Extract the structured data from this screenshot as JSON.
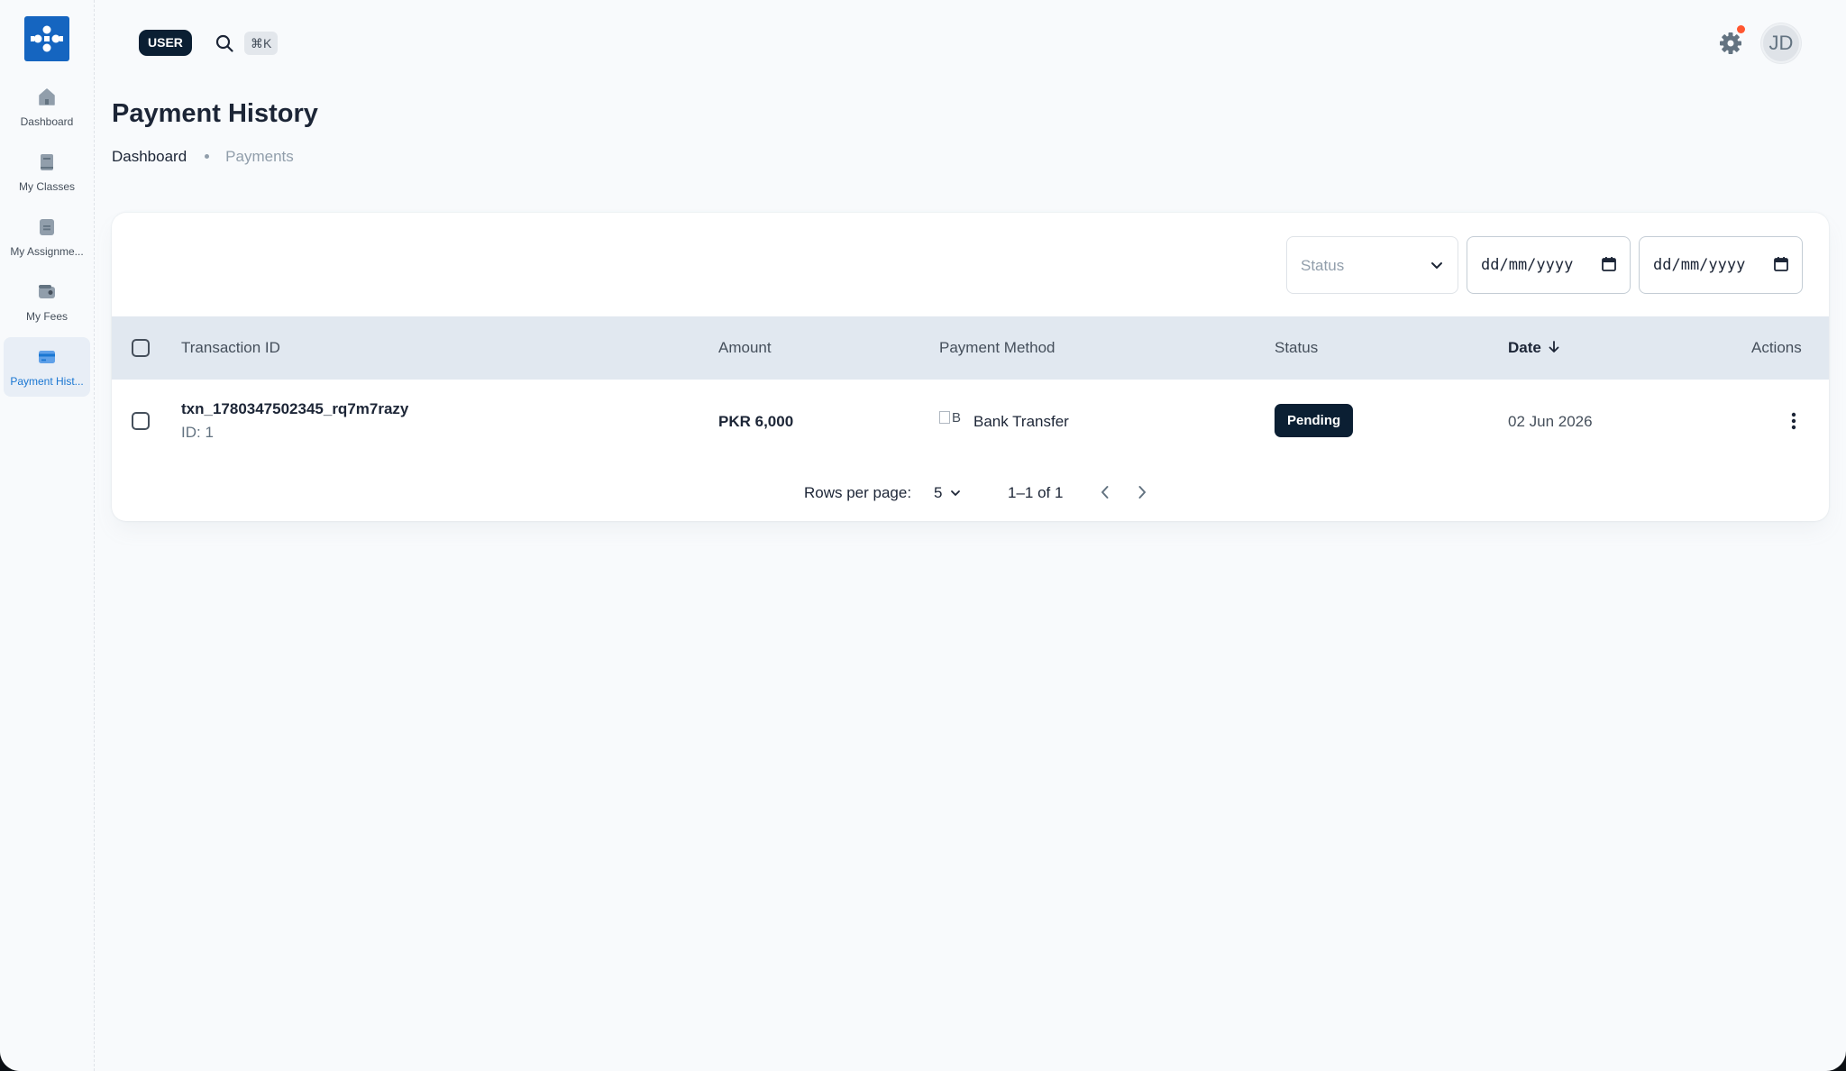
{
  "sidebar": {
    "items": [
      {
        "label": "Dashboard",
        "icon": "home-icon"
      },
      {
        "label": "My Classes",
        "icon": "book-icon"
      },
      {
        "label": "My Assignme...",
        "icon": "document-icon"
      },
      {
        "label": "My Fees",
        "icon": "wallet-icon"
      },
      {
        "label": "Payment Hist...",
        "icon": "credit-card-icon",
        "active": true
      }
    ]
  },
  "header": {
    "role_chip": "USER",
    "search_shortcut": "⌘K",
    "avatar_initials": "JD"
  },
  "page": {
    "title": "Payment History",
    "breadcrumb": {
      "home": "Dashboard",
      "current": "Payments"
    }
  },
  "filters": {
    "status_placeholder": "Status",
    "date_from_placeholder": "dd/mm/yyyy",
    "date_to_placeholder": "dd/mm/yyyy"
  },
  "table": {
    "columns": {
      "transaction_id": "Transaction ID",
      "amount": "Amount",
      "payment_method": "Payment Method",
      "status": "Status",
      "date": "Date",
      "actions": "Actions"
    },
    "sorted_by": "Date",
    "rows": [
      {
        "transaction_id": "txn_1780347502345_rq7m7razy",
        "id_label": "ID: 1",
        "amount": "PKR 6,000",
        "method_img_alt": "B",
        "payment_method": "Bank Transfer",
        "status": "Pending",
        "date": "02 Jun 2026"
      }
    ]
  },
  "pagination": {
    "rows_per_page_label": "Rows per page:",
    "rows_per_page": "5",
    "range": "1–1 of 1"
  },
  "colors": {
    "brand": "#1565c0",
    "dark": "#0b1f33",
    "header_row": "#e1e8f0",
    "notification": "#ff5630",
    "active_nav": "#1976d2"
  }
}
